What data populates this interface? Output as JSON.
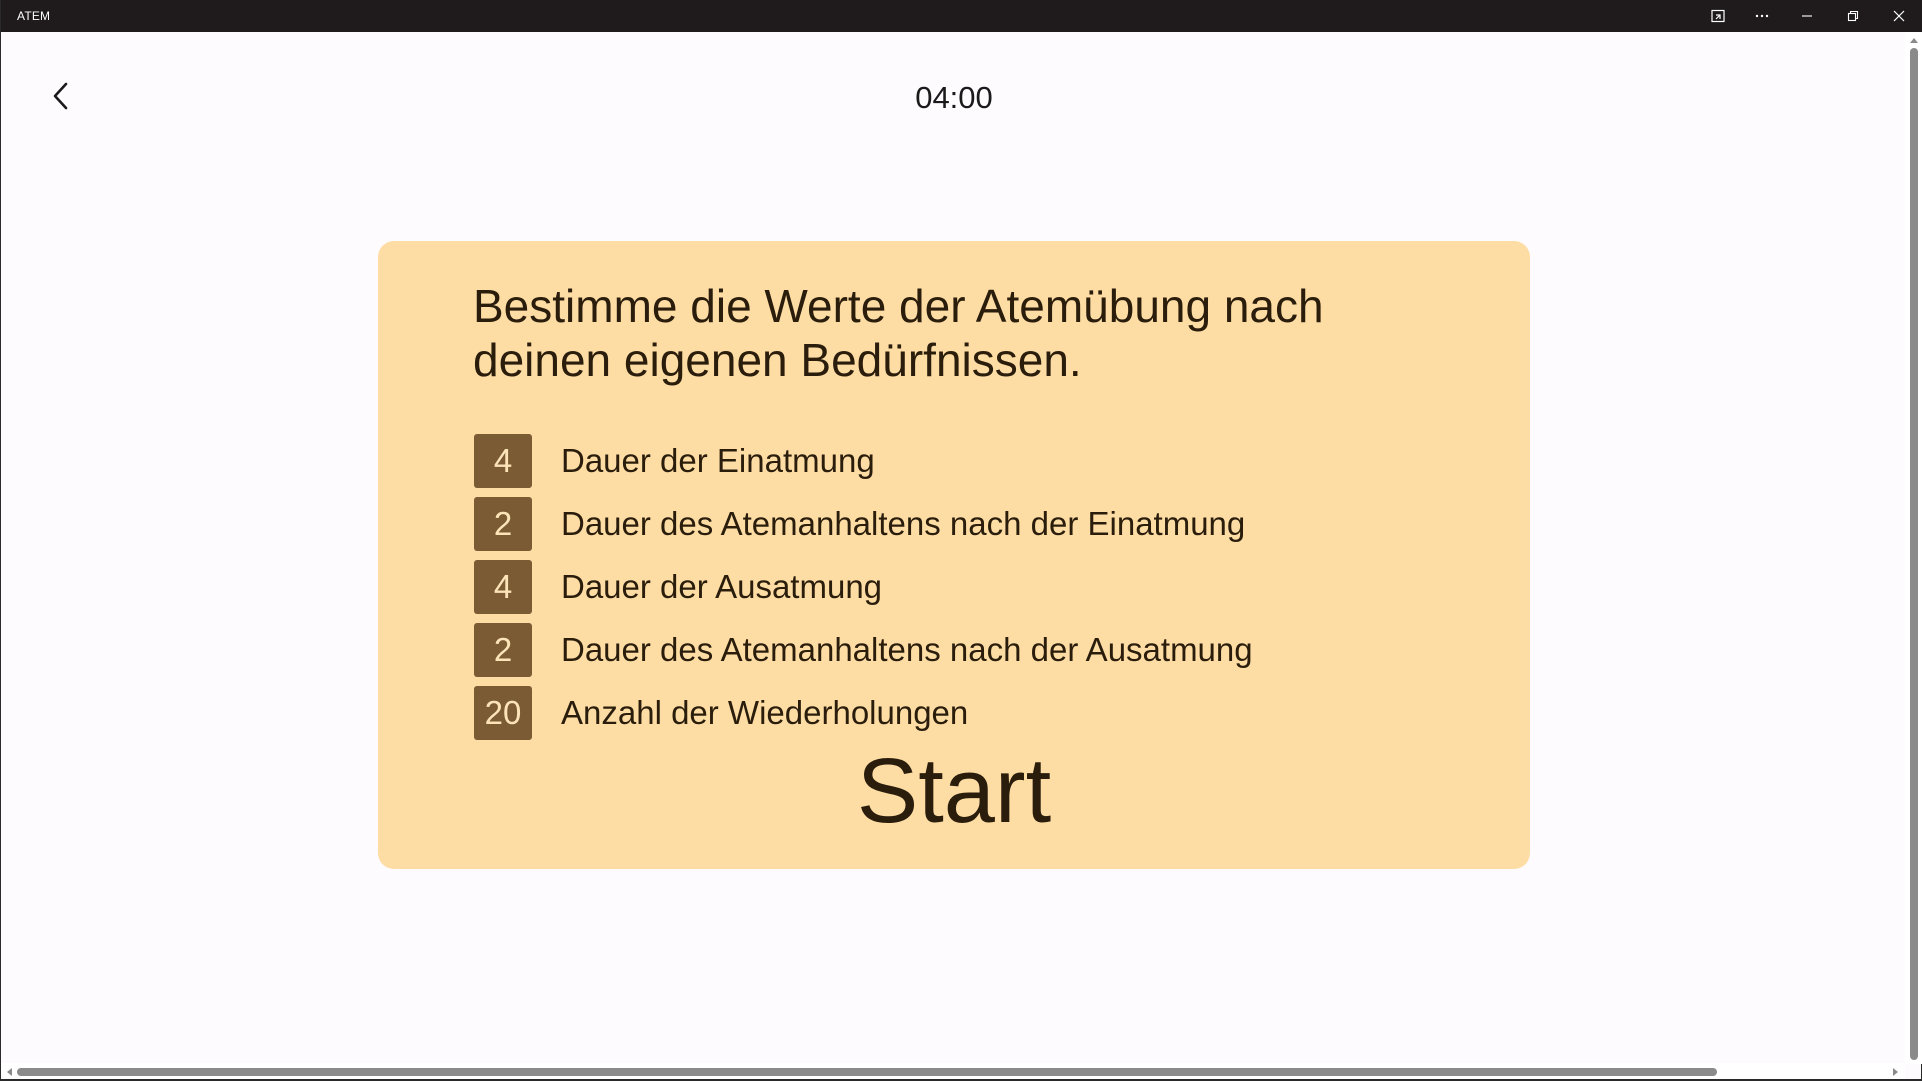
{
  "window": {
    "title": "ATEM"
  },
  "header": {
    "timer": "04:00"
  },
  "card": {
    "heading": "Bestimme die Werte der Atemübung nach deinen eigenen Bedürfnissen.",
    "rows": [
      {
        "value": "4",
        "label": "Dauer der Einatmung"
      },
      {
        "value": "2",
        "label": "Dauer des Atemanhaltens nach der Einatmung"
      },
      {
        "value": "4",
        "label": "Dauer der Ausatmung"
      },
      {
        "value": "2",
        "label": "Dauer des Atemanhaltens nach der Ausatmung"
      },
      {
        "value": "20",
        "label": "Anzahl der Wiederholungen"
      }
    ],
    "start_label": "Start"
  },
  "colors": {
    "card_background": "#fedda5",
    "value_box": "#7a5b34",
    "title_bar": "#1f1b1c"
  },
  "icons": {
    "back": "chevron-left-icon",
    "compact_overlay": "compact-overlay-icon",
    "more": "more-icon",
    "minimize": "minimize-icon",
    "restore": "restore-icon",
    "close": "close-icon"
  }
}
